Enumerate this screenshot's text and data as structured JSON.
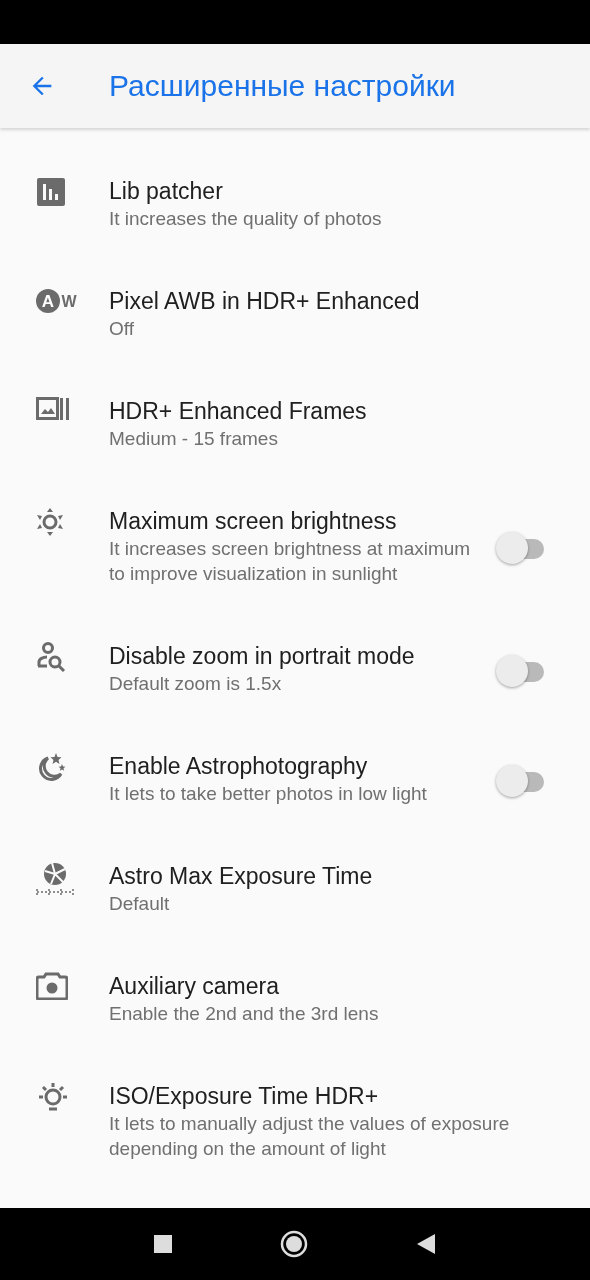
{
  "app_bar": {
    "title": "Расширенные настройки"
  },
  "settings": [
    {
      "kind": "value",
      "title": "Lib patcher",
      "summary": "It increases the quality of photos"
    },
    {
      "kind": "value",
      "icon_letters": [
        "A",
        "W"
      ],
      "title": "Pixel AWB in HDR+ Enhanced",
      "summary": "Off"
    },
    {
      "kind": "value",
      "title": "HDR+ Enhanced Frames",
      "summary": "Medium - 15 frames"
    },
    {
      "kind": "switch",
      "title": "Maximum screen brightness",
      "summary": "It increases screen brightness at maximum to improve visualization in sunlight",
      "on": false
    },
    {
      "kind": "switch",
      "title": "Disable zoom in portrait mode",
      "summary": "Default zoom is 1.5x",
      "on": false
    },
    {
      "kind": "switch",
      "title": "Enable Astrophotography",
      "summary": "It lets to take better photos in low light",
      "on": false
    },
    {
      "kind": "value",
      "title": "Astro Max Exposure Time",
      "summary": "Default"
    },
    {
      "kind": "value",
      "title": "Auxiliary camera",
      "summary": "Enable the 2nd and the 3rd lens"
    },
    {
      "kind": "value",
      "title": "ISO/Exposure Time HDR+",
      "summary": "It lets to manually adjust the values of exposure depending on the amount of light"
    }
  ]
}
